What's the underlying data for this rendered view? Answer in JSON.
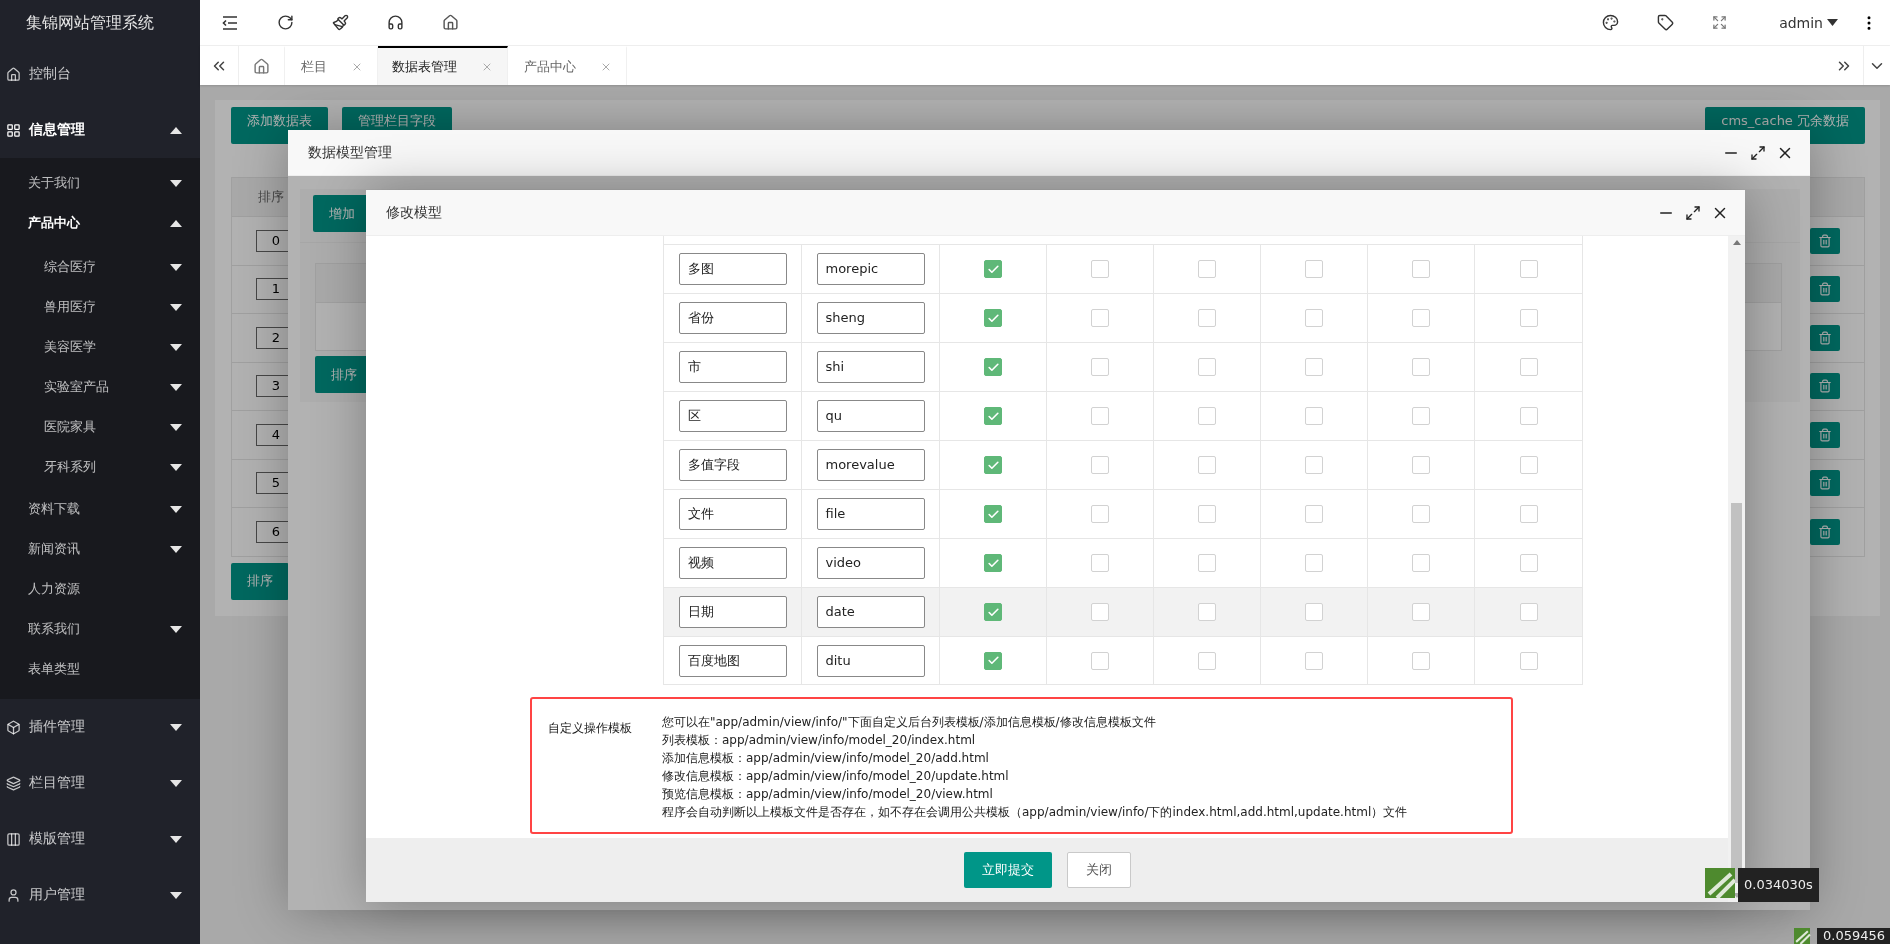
{
  "sidebar": {
    "title": "集锦网站管理系统",
    "items": [
      {
        "label": "控制台"
      },
      {
        "label": "信息管理",
        "expanded": true,
        "children": [
          {
            "label": "关于我们",
            "expanded": false
          },
          {
            "label": "产品中心",
            "expanded": true,
            "children": [
              {
                "label": "综合医疗",
                "expanded": false
              },
              {
                "label": "兽用医疗",
                "expanded": false
              },
              {
                "label": "美容医学",
                "expanded": false
              },
              {
                "label": "实验室产品",
                "expanded": false
              },
              {
                "label": "医院家具",
                "expanded": false
              },
              {
                "label": "牙科系列",
                "expanded": false
              }
            ]
          },
          {
            "label": "资料下载",
            "expanded": false
          },
          {
            "label": "新闻资讯",
            "expanded": false
          },
          {
            "label": "人力资源"
          },
          {
            "label": "联系我们",
            "expanded": false
          },
          {
            "label": "表单类型"
          }
        ]
      },
      {
        "label": "插件管理",
        "expanded": false
      },
      {
        "label": "栏目管理",
        "expanded": false
      },
      {
        "label": "模版管理",
        "expanded": false
      },
      {
        "label": "用户管理",
        "expanded": false
      }
    ]
  },
  "header": {
    "user": "admin"
  },
  "tabs": [
    {
      "kind": "home",
      "selected": false
    },
    {
      "kind": "page",
      "label": "栏目",
      "selected": false
    },
    {
      "kind": "page",
      "label": "数据表管理",
      "selected": true
    },
    {
      "kind": "page",
      "label": "产品中心",
      "selected": false
    }
  ],
  "page": {
    "buttons": [
      "添加数据表",
      "管理栏目字段"
    ],
    "cache_button": "cms_cache 冗余数据",
    "table_header": "排序",
    "rows": [
      "0",
      "1",
      "2",
      "3",
      "4",
      "5",
      "6"
    ],
    "sort_button": "排序"
  },
  "outer_dialog": {
    "title": "数据模型管理",
    "add_button": "增加",
    "sort_button": "排序"
  },
  "dialog": {
    "title": "修改模型",
    "fields": [
      {
        "name": "多图",
        "field": "morepic",
        "checks": [
          true,
          false,
          false,
          false,
          false,
          false
        ],
        "hovered": false
      },
      {
        "name": "省份",
        "field": "sheng",
        "checks": [
          true,
          false,
          false,
          false,
          false,
          false
        ],
        "hovered": false
      },
      {
        "name": "市",
        "field": "shi",
        "checks": [
          true,
          false,
          false,
          false,
          false,
          false
        ],
        "hovered": false
      },
      {
        "name": "区",
        "field": "qu",
        "checks": [
          true,
          false,
          false,
          false,
          false,
          false
        ],
        "hovered": false
      },
      {
        "name": "多值字段",
        "field": "morevalue",
        "checks": [
          true,
          false,
          false,
          false,
          false,
          false
        ],
        "hovered": false
      },
      {
        "name": "文件",
        "field": "file",
        "checks": [
          true,
          false,
          false,
          false,
          false,
          false
        ],
        "hovered": false
      },
      {
        "name": "视频",
        "field": "video",
        "checks": [
          true,
          false,
          false,
          false,
          false,
          false
        ],
        "hovered": false
      },
      {
        "name": "日期",
        "field": "date",
        "checks": [
          true,
          false,
          false,
          false,
          false,
          false
        ],
        "hovered": true
      },
      {
        "name": "百度地图",
        "field": "ditu",
        "checks": [
          true,
          false,
          false,
          false,
          false,
          false
        ],
        "hovered": false
      }
    ],
    "template": {
      "label": "自定义操作模板",
      "lines": [
        "您可以在\"app/admin/view/info/\"下面自定义后台列表模板/添加信息模板/修改信息模板文件",
        "列表模板：app/admin/view/info/model_20/index.html",
        "添加信息模板：app/admin/view/info/model_20/add.html",
        "修改信息模板：app/admin/view/info/model_20/update.html",
        "预览信息模板：app/admin/view/info/model_20/view.html",
        "程序会自动判断以上模板文件是否存在，如不存在会调用公共模板（app/admin/view/info/下的index.html,add.html,update.html）文件"
      ]
    },
    "buttons": [
      "立即提交",
      "关闭"
    ]
  },
  "timers": [
    "0.034030s",
    "0.059456"
  ]
}
